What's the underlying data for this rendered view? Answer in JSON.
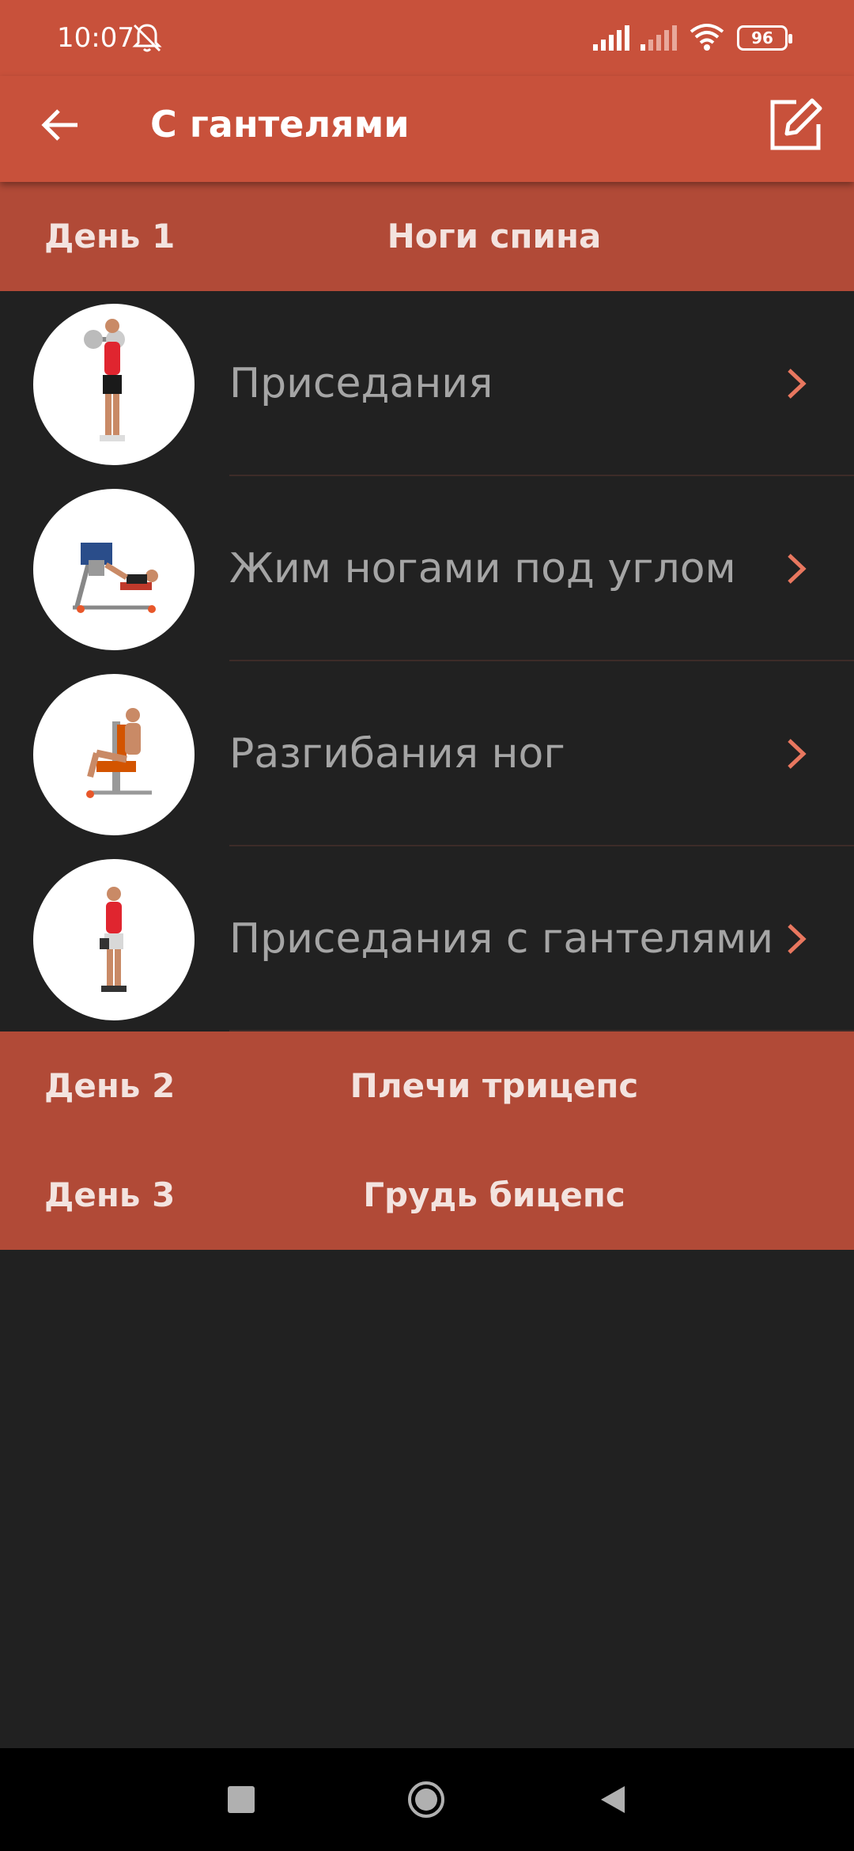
{
  "status_bar": {
    "time": "10:07",
    "battery": "96",
    "icons": [
      "bell-muted-icon",
      "signal-icon",
      "signal-weak-icon",
      "wifi-icon",
      "battery-icon"
    ]
  },
  "app_bar": {
    "title": "С гантелями",
    "back_icon": "arrow-back-icon",
    "edit_icon": "edit-icon"
  },
  "days": [
    {
      "label": "День 1",
      "name": "Ноги спина",
      "exercises": [
        {
          "name": "Приседания",
          "icon": "squat-illustration"
        },
        {
          "name": "Жим ногами под углом",
          "icon": "leg-press-illustration"
        },
        {
          "name": "Разгибания ног",
          "icon": "leg-extension-illustration"
        },
        {
          "name": "Приседания с гантелями",
          "icon": "dumbbell-squat-illustration"
        }
      ]
    },
    {
      "label": "День 2",
      "name": "Плечи трицепс"
    },
    {
      "label": "День 3",
      "name": "Грудь бицепс"
    }
  ],
  "colors": {
    "primary": "#c8513b",
    "header": "#b14a37",
    "background": "#212121",
    "chevron": "#e8775f",
    "item_text": "#a5a5a5"
  },
  "nav_bar": {
    "icons": [
      "recent-apps-icon",
      "home-icon",
      "back-nav-icon"
    ]
  }
}
